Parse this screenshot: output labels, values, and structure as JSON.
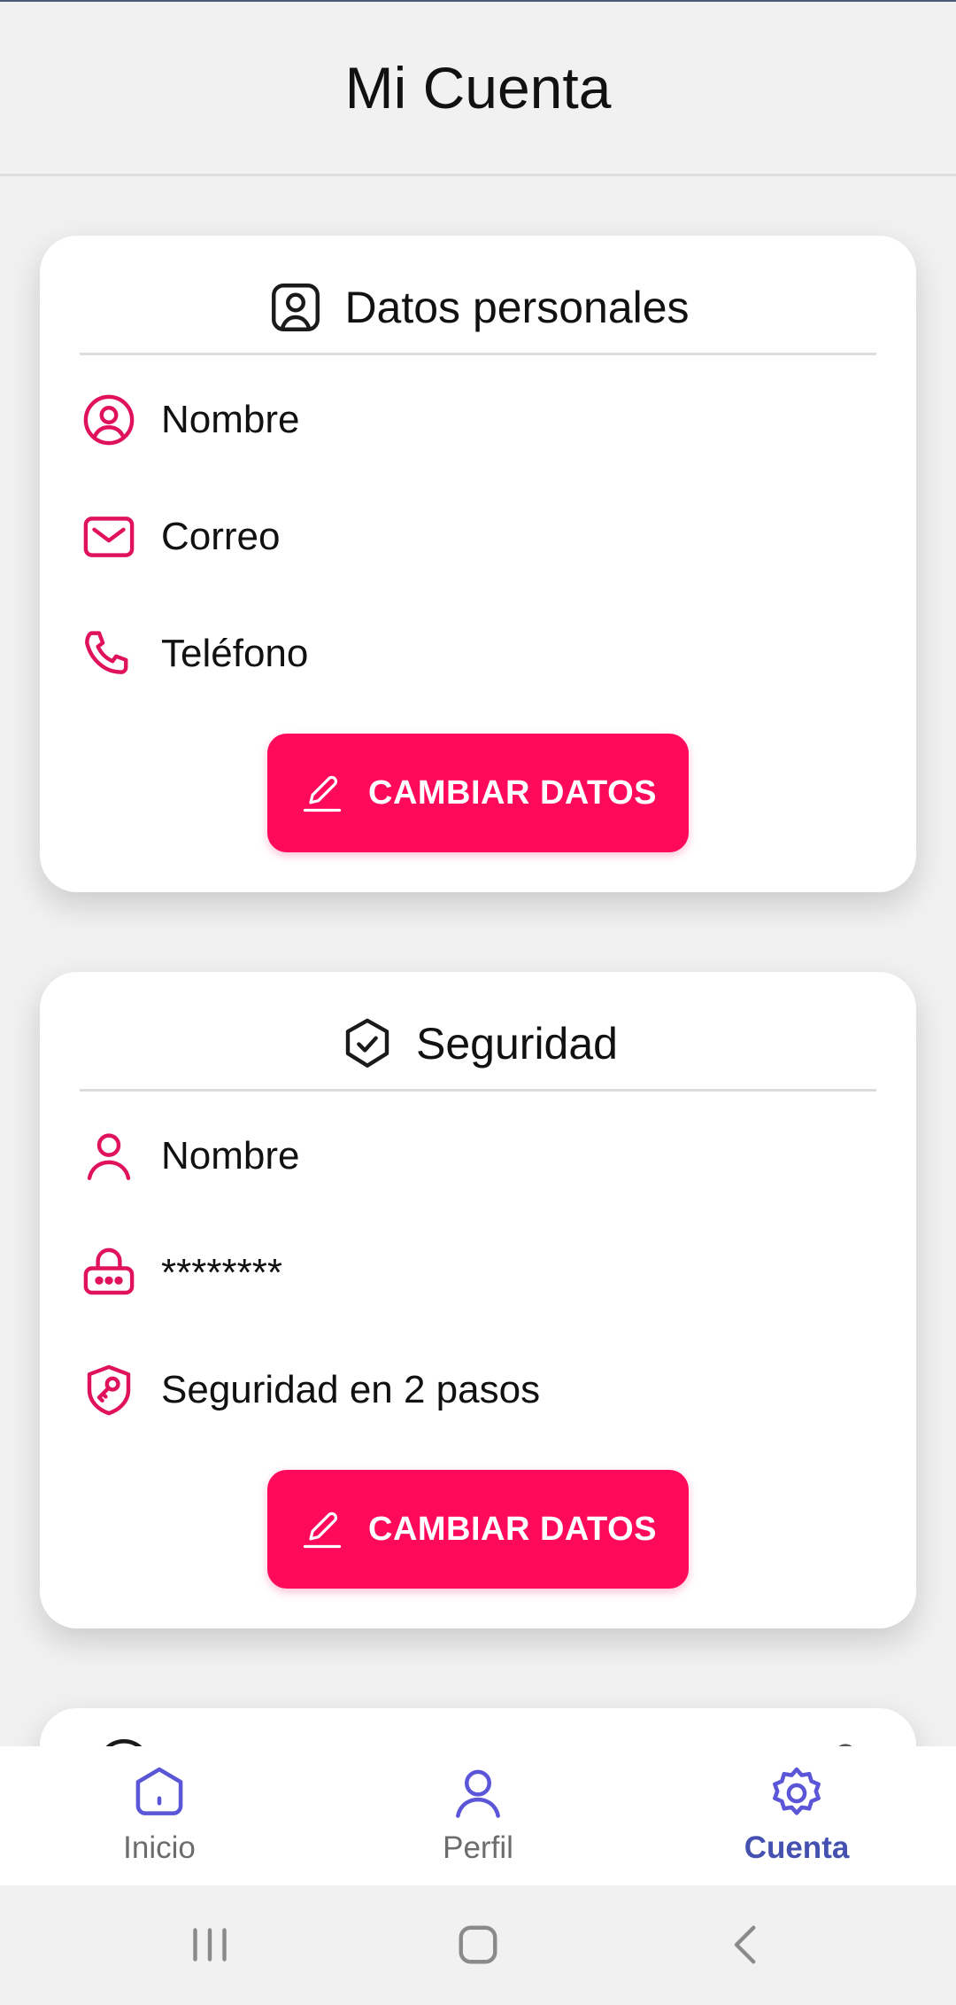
{
  "header": {
    "title": "Mi Cuenta"
  },
  "colors": {
    "accent": "#ff0a5b",
    "nav_active": "#4451b0",
    "nav_inactive": "#6c6c6c"
  },
  "personal": {
    "title": "Datos personales",
    "icon": "user-square-icon",
    "rows": [
      {
        "icon": "user-circle-icon",
        "label": "Nombre"
      },
      {
        "icon": "mail-icon",
        "label": "Correo"
      },
      {
        "icon": "phone-icon",
        "label": "Teléfono"
      }
    ],
    "button_label": "CAMBIAR DATOS"
  },
  "security": {
    "title": "Seguridad",
    "icon": "shield-check-icon",
    "rows": [
      {
        "icon": "user-icon",
        "label": "Nombre"
      },
      {
        "icon": "password-lock-icon",
        "label": "********"
      },
      {
        "icon": "shield-key-icon",
        "label": "Seguridad en 2 pasos"
      }
    ],
    "button_label": "CAMBIAR DATOS"
  },
  "nav": {
    "items": [
      {
        "icon": "home-icon",
        "label": "Inicio",
        "active": false
      },
      {
        "icon": "profile-icon",
        "label": "Perfil",
        "active": false
      },
      {
        "icon": "gear-icon",
        "label": "Cuenta",
        "active": true
      }
    ]
  },
  "system_nav": [
    "recent-apps-icon",
    "home-button-icon",
    "back-icon"
  ]
}
